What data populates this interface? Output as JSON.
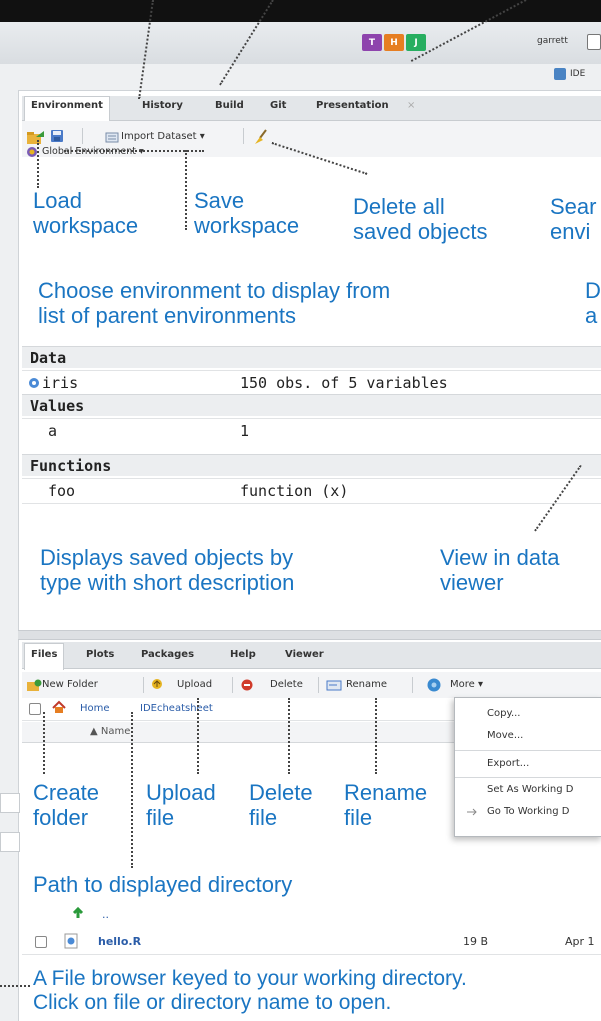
{
  "header": {
    "badges": [
      {
        "label": "T",
        "color": "#8e44ad"
      },
      {
        "label": "H",
        "color": "#e67e22"
      },
      {
        "label": "J",
        "color": "#27ae60"
      }
    ],
    "user": "garrett",
    "project": "IDE"
  },
  "env_pane": {
    "tabs": [
      "Environment",
      "History",
      "Build",
      "Git",
      "Presentation"
    ],
    "toolbar": {
      "import_label": "Import Dataset ▾",
      "global_env_label": "Global Environment ▾"
    },
    "sections": [
      {
        "title": "Data",
        "rows": [
          {
            "name": "iris",
            "value": "150 obs. of 5 variables"
          }
        ]
      },
      {
        "title": "Values",
        "rows": [
          {
            "name": "a",
            "value": "1"
          }
        ]
      },
      {
        "title": "Functions",
        "rows": [
          {
            "name": "foo",
            "value": "function (x)"
          }
        ]
      }
    ]
  },
  "files_pane": {
    "tabs": [
      "Files",
      "Plots",
      "Packages",
      "Help",
      "Viewer"
    ],
    "toolbar": {
      "new_folder": "New Folder",
      "upload": "Upload",
      "delete": "Delete",
      "rename": "Rename",
      "more": "More ▾"
    },
    "path": {
      "home": "Home",
      "dir": "IDEcheatsheet"
    },
    "name_header": "▲ Name",
    "more_menu": [
      "Copy...",
      "Move...",
      "Export...",
      "Set As Working D",
      "Go To Working D"
    ],
    "files": [
      {
        "name": "..",
        "size": "",
        "modified": ""
      },
      {
        "name": "hello.R",
        "size": "19 B",
        "modified": "Apr 1"
      }
    ]
  },
  "annotations": {
    "load_workspace": [
      "Load",
      "workspace"
    ],
    "save_workspace": [
      "Save",
      "workspace"
    ],
    "delete_all": [
      "Delete all",
      "saved objects"
    ],
    "search_env": [
      "Sear",
      "envi"
    ],
    "choose_env": [
      "Choose environment to display from",
      "list of parent environments"
    ],
    "display_env_cut": [
      "D",
      "a"
    ],
    "displays_saved": [
      "Displays saved objects by",
      "type with short description"
    ],
    "view_data": [
      "View in data",
      "viewer"
    ],
    "create_folder": [
      "Create",
      "folder"
    ],
    "upload_file": [
      "Upload",
      "file"
    ],
    "delete_file": [
      "Delete",
      "file"
    ],
    "rename_file": [
      "Rename",
      "file"
    ],
    "path_displayed": "Path to displayed directory",
    "file_browser": [
      "A File browser keyed to your working directory.",
      "Click on file or directory name to open."
    ]
  }
}
